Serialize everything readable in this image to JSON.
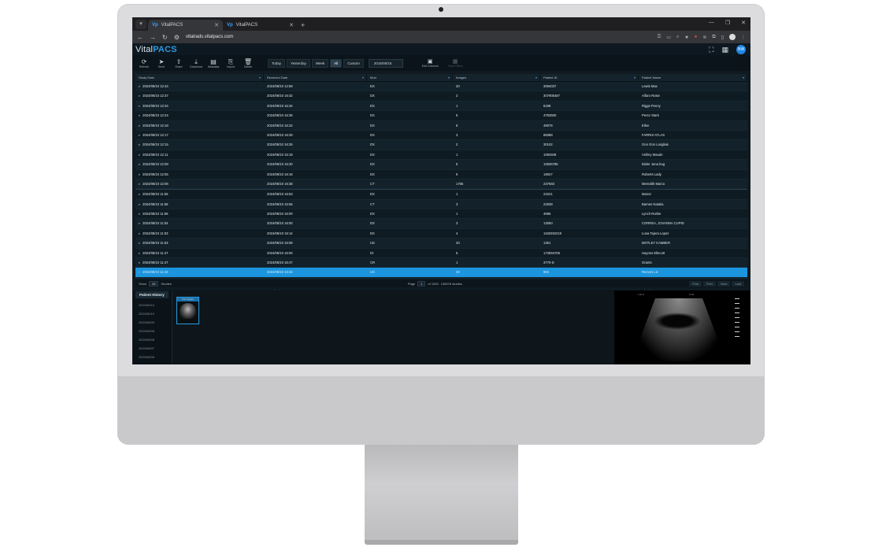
{
  "browser": {
    "tabs": [
      {
        "label": "VitalPACS",
        "active": true
      },
      {
        "label": "VitalPACS",
        "active": false
      }
    ],
    "url": "vitalrads.vitalpacs.com"
  },
  "app": {
    "logo_prefix": "Vital",
    "logo_suffix": "PACS",
    "user_initials": "NW"
  },
  "toolbar": {
    "buttons": [
      {
        "label": "Refresh",
        "icon": "refresh-icon"
      },
      {
        "label": "Send",
        "icon": "send-icon"
      },
      {
        "label": "Share",
        "icon": "share-icon"
      },
      {
        "label": "Download",
        "icon": "download-icon"
      },
      {
        "label": "Metadata",
        "icon": "metadata-icon"
      },
      {
        "label": "Import",
        "icon": "import-icon"
      },
      {
        "label": "Delete",
        "icon": "delete-icon"
      }
    ],
    "date_filters": [
      "Today",
      "Yesterday",
      "Week",
      "All",
      "Custom"
    ],
    "selected_filter": "All",
    "date_value": "2015/05/15",
    "edit_columns_label": "Edit Columns",
    "clear_filters_label": "Clear Filters"
  },
  "table": {
    "columns": [
      "Study Date",
      "Received Date",
      "Mod",
      "Images",
      "Patient ID",
      "Patient Name"
    ],
    "rows": [
      [
        "2024/06/10 12:44",
        "2024/06/10 12:59",
        "DX",
        "20",
        "3094037",
        "Lewis Max"
      ],
      [
        "2024/06/10 12:37",
        "2024/06/10 16:42",
        "DX",
        "2",
        "307905487",
        "Alfaro Rosie"
      ],
      [
        "2024/06/10 12:34",
        "2024/06/10 16:34",
        "DX",
        "1",
        "6198",
        "Riggs Penny"
      ],
      [
        "2024/06/10 12:24",
        "2024/06/10 16:36",
        "DX",
        "5",
        "4793500",
        "Perez Stark"
      ],
      [
        "2024/06/10 12:18",
        "2024/06/10 16:24",
        "DX",
        "8",
        "49076",
        "Ellen"
      ],
      [
        "2024/06/10 12:17",
        "2024/06/10 16:29",
        "DX",
        "3",
        "68388",
        "FARRIS ATLAS"
      ],
      [
        "2024/06/10 12:15",
        "2024/06/10 16:26",
        "DX",
        "2",
        "30102",
        "Gon Gon Langlais"
      ],
      [
        "2024/06/10 12:11",
        "2024/06/10 16:19",
        "DX",
        "1",
        "1092848",
        "Ashley Maude"
      ],
      [
        "2024/06/10 12:08",
        "2024/06/10 16:20",
        "DX",
        "5",
        "10835785",
        "Bieler Juna bug"
      ],
      [
        "2024/06/10 12:05",
        "2024/06/10 16:16",
        "DX",
        "9",
        "19027",
        "Roberts Lady"
      ],
      [
        "2024/06/10 12:06",
        "2024/06/10 16:38",
        "CT",
        "1765",
        "237583",
        "Meredith Marco"
      ],
      [
        "2024/06/10 11:55",
        "2024/06/10 16:53",
        "DX",
        "1",
        "24221",
        "Manor"
      ],
      [
        "2024/06/10 11:56",
        "2024/06/10 15:55",
        "CT",
        "3",
        "22938",
        "Barnes Natalia"
      ],
      [
        "2024/06/10 11:56",
        "2024/06/10 16:00",
        "DX",
        "1",
        "4695",
        "Lynch Ruthie"
      ],
      [
        "2024/06/10 11:54",
        "2024/06/10 16:00",
        "DX",
        "3",
        "13050",
        "CORREA, JOVANNA CUPID"
      ],
      [
        "2024/06/10 11:53",
        "2024/06/10 16:14",
        "DX",
        "4",
        "1160292219",
        "Luna Tajera Lopez"
      ],
      [
        "2024/06/10 11:53",
        "2024/06/10 16:08",
        "US",
        "20",
        "1351",
        "MOTLEY KAMBER"
      ],
      [
        "2024/06/10 11:47",
        "2024/06/10 16:00",
        "IO",
        "5",
        "173694706",
        "Haynes Ellecott"
      ],
      [
        "2024/06/10 11:47",
        "2024/06/10 16:47",
        "CR",
        "1",
        "3770-D",
        "Grants"
      ],
      [
        "2024/06/10 11:43",
        "2024/06/10 16:34",
        "US",
        "39",
        "984",
        "Reeves Liz"
      ],
      [
        "2024/06/10 11:42",
        "2024/06/10 16:56",
        "IO",
        "6",
        "350489380",
        "GuatiSasha"
      ],
      [
        "2024/06/10 11:41",
        "2024/06/10 16:46",
        "DX",
        "2",
        "16204",
        "Bland Bogey"
      ]
    ],
    "selected_row": 19
  },
  "pager": {
    "show_label": "Show",
    "page_size": "25",
    "studies_label": "Studies",
    "page_label": "Page",
    "page_value": "1",
    "of_pages": "of 1093",
    "total": "136976 studies",
    "first": "First",
    "prev": "Prev",
    "next": "Next",
    "last": "Last"
  },
  "history": {
    "tab_label": "Patient History",
    "dates": [
      "2024/06/10",
      "2024/06/10",
      "2024/06/09",
      "2024/06/08",
      "2024/06/08",
      "2024/06/07",
      "2024/06/06"
    ],
    "thumb_caption": "US Images"
  },
  "colors": {
    "accent": "#1b95de",
    "logo_blue": "#2a9be0",
    "background": "#101a20"
  }
}
